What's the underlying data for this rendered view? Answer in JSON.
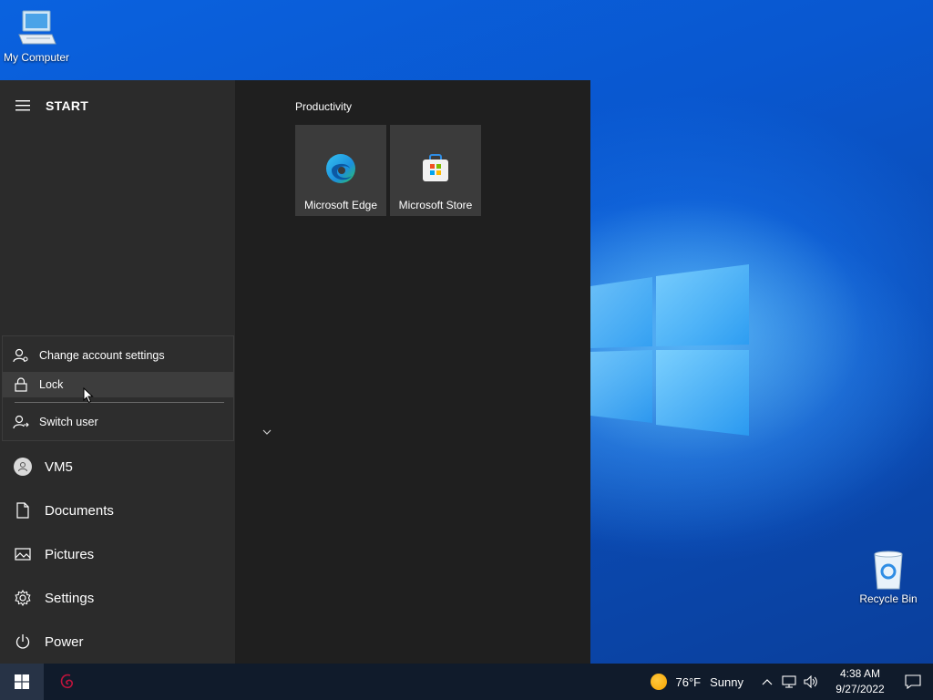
{
  "desktop": {
    "icons": [
      {
        "label": "My Computer",
        "icon": "computer-icon"
      },
      {
        "label": "Recycle Bin",
        "icon": "recycle-bin-icon"
      }
    ]
  },
  "start_menu": {
    "title": "START",
    "account_flyout": {
      "items": [
        {
          "label": "Change account settings",
          "icon": "account-settings-icon"
        },
        {
          "label": "Lock",
          "icon": "lock-icon"
        },
        {
          "label": "Switch user",
          "icon": "switch-user-icon"
        }
      ]
    },
    "nav": [
      {
        "label": "VM5",
        "icon": "user-avatar-icon"
      },
      {
        "label": "Documents",
        "icon": "document-icon"
      },
      {
        "label": "Pictures",
        "icon": "picture-icon"
      },
      {
        "label": "Settings",
        "icon": "gear-icon"
      },
      {
        "label": "Power",
        "icon": "power-icon"
      }
    ],
    "tile_group": {
      "label": "Productivity",
      "tiles": [
        {
          "label": "Microsoft Edge",
          "icon": "edge-icon"
        },
        {
          "label": "Microsoft Store",
          "icon": "store-icon"
        }
      ]
    }
  },
  "taskbar": {
    "weather": {
      "temp": "76°F",
      "condition": "Sunny"
    },
    "clock": {
      "time": "4:38 AM",
      "date": "9/27/2022"
    }
  },
  "colors": {
    "start_bg": "#1f1f1f",
    "start_left_bg": "#2b2b2b",
    "tile_bg": "#3b3b3b",
    "taskbar_bg": "#101b2b"
  }
}
